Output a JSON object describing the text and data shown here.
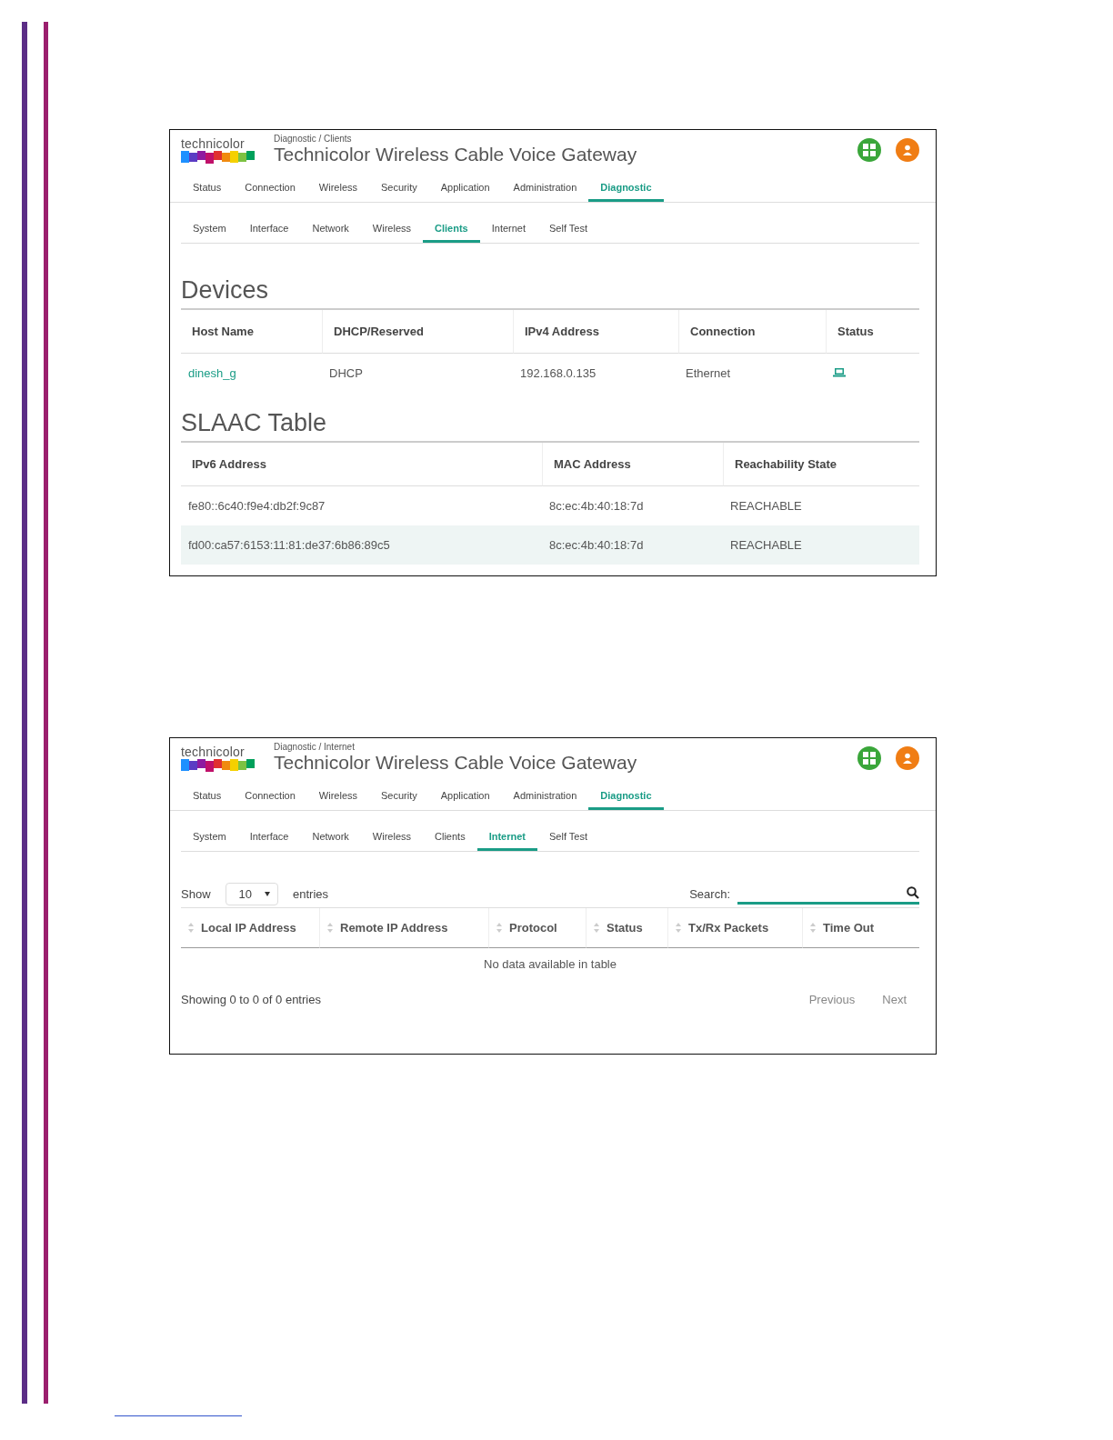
{
  "screens": [
    {
      "kind": "clients",
      "logo": "technicolor",
      "breadcrumb": "Diagnostic / Clients",
      "title": "Technicolor Wireless Cable Voice Gateway",
      "nav": [
        {
          "label": "Status",
          "selected": false
        },
        {
          "label": "Connection",
          "selected": false
        },
        {
          "label": "Wireless",
          "selected": false
        },
        {
          "label": "Security",
          "selected": false
        },
        {
          "label": "Application",
          "selected": false
        },
        {
          "label": "Administration",
          "selected": false
        },
        {
          "label": "Diagnostic",
          "selected": true
        }
      ],
      "subnav": [
        {
          "label": "System",
          "selected": false
        },
        {
          "label": "Interface",
          "selected": false
        },
        {
          "label": "Network",
          "selected": false
        },
        {
          "label": "Wireless",
          "selected": false
        },
        {
          "label": "Clients",
          "selected": true
        },
        {
          "label": "Internet",
          "selected": false
        },
        {
          "label": "Self Test",
          "selected": false
        }
      ],
      "devices": {
        "heading": "Devices",
        "columns": [
          "Host Name",
          "DHCP/Reserved",
          "IPv4 Address",
          "Connection",
          "Status"
        ],
        "rows": [
          {
            "host_name": "dinesh_g",
            "dhcp_reserved": "DHCP",
            "ipv4_address": "192.168.0.135",
            "connection": "Ethernet"
          }
        ]
      },
      "slaac": {
        "heading": "SLAAC Table",
        "columns": [
          "IPv6 Address",
          "MAC Address",
          "Reachability State"
        ],
        "rows": [
          {
            "ipv6_address": "fe80::6c40:f9e4:db2f:9c87",
            "mac_address": "8c:ec:4b:40:18:7d",
            "reachability_state": "REACHABLE",
            "highlighted": false
          },
          {
            "ipv6_address": "fd00:ca57:6153:11:81:de37:6b86:89c5",
            "mac_address": "8c:ec:4b:40:18:7d",
            "reachability_state": "REACHABLE",
            "highlighted": true
          }
        ]
      }
    },
    {
      "kind": "internet",
      "logo": "technicolor",
      "breadcrumb": "Diagnostic / Internet",
      "title": "Technicolor Wireless Cable Voice Gateway",
      "nav": [
        {
          "label": "Status",
          "selected": false
        },
        {
          "label": "Connection",
          "selected": false
        },
        {
          "label": "Wireless",
          "selected": false
        },
        {
          "label": "Security",
          "selected": false
        },
        {
          "label": "Application",
          "selected": false
        },
        {
          "label": "Administration",
          "selected": false
        },
        {
          "label": "Diagnostic",
          "selected": true
        }
      ],
      "subnav": [
        {
          "label": "System",
          "selected": false
        },
        {
          "label": "Interface",
          "selected": false
        },
        {
          "label": "Network",
          "selected": false
        },
        {
          "label": "Wireless",
          "selected": false
        },
        {
          "label": "Clients",
          "selected": false
        },
        {
          "label": "Internet",
          "selected": true
        },
        {
          "label": "Self Test",
          "selected": false
        }
      ],
      "show_label": "Show",
      "page_size": "10",
      "entries_label": "entries",
      "search_label": "Search:",
      "columns": [
        "Local IP Address",
        "Remote IP Address",
        "Protocol",
        "Status",
        "Tx/Rx Packets",
        "Time Out"
      ],
      "empty_message": "No data available in table",
      "info": "Showing 0 to 0 of 0 entries",
      "previous": "Previous",
      "next": "Next"
    }
  ]
}
